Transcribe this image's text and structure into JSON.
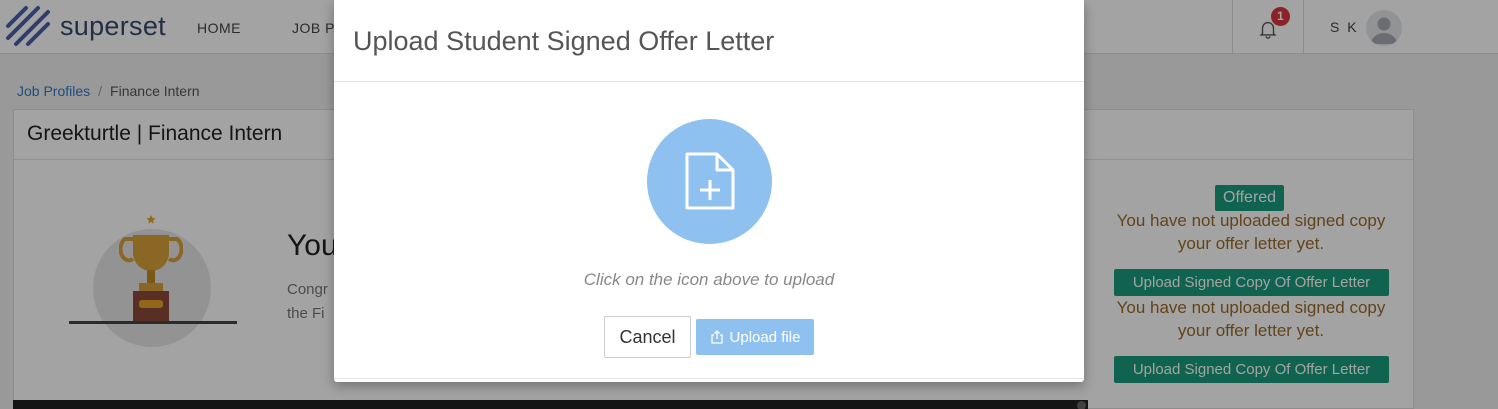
{
  "app": {
    "brand": "superset",
    "nav": [
      "HOME",
      "JOB P"
    ],
    "notification_count": "1",
    "user_initials": "S K"
  },
  "breadcrumb": {
    "link": "Job Profiles",
    "separator": "/",
    "current": "Finance Intern"
  },
  "card": {
    "title": "Greekturtle | Finance Intern",
    "headline_partial": "You",
    "body_partial_1": "Congr",
    "body_partial_2": "the Fi"
  },
  "status": {
    "badge": "Offered",
    "message": "You have not uploaded signed copy your offer letter yet.",
    "upload_button": "Upload Signed Copy Of Offer Letter"
  },
  "modal": {
    "title": "Upload Student Signed Offer Letter",
    "hint": "Click on the icon above to upload",
    "cancel_label": "Cancel",
    "upload_label": "Upload file"
  },
  "colors": {
    "accent_green": "#1a9b7a",
    "upload_blue": "#8fc1f0",
    "badge_red": "#d9363e",
    "warning_text": "#9a6b2a"
  },
  "icons": {
    "brand": "superset-logo-icon",
    "notifications": "bell-icon",
    "avatar": "user-avatar-icon",
    "upload_area": "file-plus-icon",
    "upload_button": "upload-icon",
    "trophy": "trophy-icon"
  }
}
